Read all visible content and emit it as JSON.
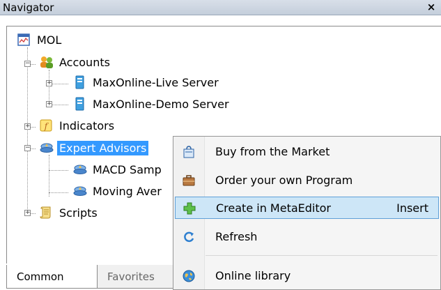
{
  "window": {
    "title": "Navigator",
    "close_glyph": "×"
  },
  "tree": {
    "root": "MOL",
    "accounts": "Accounts",
    "live_server": "MaxOnline-Live Server",
    "demo_server": "MaxOnline-Demo Server",
    "indicators": "Indicators",
    "expert_advisors": "Expert Advisors",
    "macd": "MACD Samp",
    "moving": "Moving Aver",
    "scripts": "Scripts"
  },
  "tabs": {
    "common": "Common",
    "favorites": "Favorites"
  },
  "context_menu": {
    "buy": "Buy from the Market",
    "order": "Order your own Program",
    "create": "Create in MetaEditor",
    "create_shortcut": "Insert",
    "refresh": "Refresh",
    "online": "Online library"
  },
  "colors": {
    "selection": "#3399ff",
    "menu_highlight": "#cde6f7",
    "menu_highlight_border": "#5fa0d8"
  }
}
